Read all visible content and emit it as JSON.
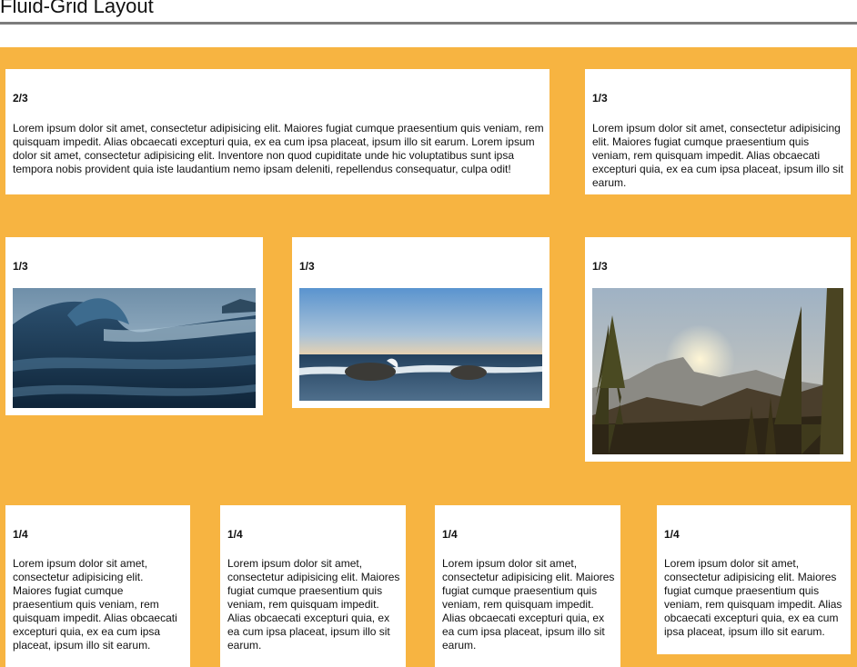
{
  "page": {
    "title": "Fluid-Grid Layout"
  },
  "rows": [
    {
      "cards": [
        {
          "label": "2/3",
          "text": "Lorem ipsum dolor sit amet, consectetur adipisicing elit. Maiores fugiat cumque praesentium quis veniam, rem quisquam impedit. Alias obcaecati excepturi quia, ex ea cum ipsa placeat, ipsum illo sit earum. Lorem ipsum dolor sit amet, consectetur adipisicing elit. Inventore non quod cupiditate unde hic voluptatibus sunt ipsa tempora nobis provident quia iste laudantium nemo ipsam deleniti, repellendus consequatur, culpa odit!"
        },
        {
          "label": "1/3",
          "text": "Lorem ipsum dolor sit amet, consectetur adipisicing elit. Maiores fugiat cumque praesentium quis veniam, rem quisquam impedit. Alias obcaecati excepturi quia, ex ea cum ipsa placeat, ipsum illo sit earum."
        }
      ]
    },
    {
      "cards": [
        {
          "label": "1/3",
          "image": "ocean-wave-photo"
        },
        {
          "label": "1/3",
          "image": "sea-rocks-sunset-photo"
        },
        {
          "label": "1/3",
          "image": "mountain-forest-sunrise-photo"
        }
      ]
    },
    {
      "cards": [
        {
          "label": "1/4",
          "text": "Lorem ipsum dolor sit amet, consectetur adipisicing elit. Maiores fugiat cumque praesentium quis veniam, rem quisquam impedit. Alias obcaecati excepturi quia, ex ea cum ipsa placeat, ipsum illo sit earum."
        },
        {
          "label": "1/4",
          "text": "Lorem ipsum dolor sit amet, consectetur adipisicing elit. Maiores fugiat cumque praesentium quis veniam, rem quisquam impedit. Alias obcaecati excepturi quia, ex ea cum ipsa placeat, ipsum illo sit earum."
        },
        {
          "label": "1/4",
          "text": "Lorem ipsum dolor sit amet, consectetur adipisicing elit. Maiores fugiat cumque praesentium quis veniam, rem quisquam impedit. Alias obcaecati excepturi quia, ex ea cum ipsa placeat, ipsum illo sit earum."
        },
        {
          "label": "1/4",
          "text": "Lorem ipsum dolor sit amet, consectetur adipisicing elit. Maiores fugiat cumque praesentium quis veniam, rem quisquam impedit. Alias obcaecati excepturi quia, ex ea cum ipsa placeat, ipsum illo sit earum."
        }
      ]
    }
  ],
  "colors": {
    "grid_background": "#f7b441",
    "card_background": "#ffffff",
    "title_rule": "#7c7c7c"
  }
}
